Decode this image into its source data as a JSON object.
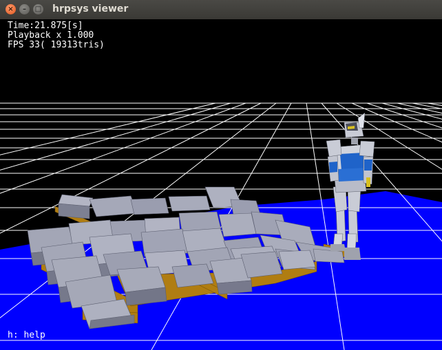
{
  "window": {
    "title": "hrpsys viewer",
    "buttons": {
      "close": "×",
      "minimize": "–",
      "maximize": "□"
    }
  },
  "overlay": {
    "time": "Time:21.875[s]",
    "playback": "Playback x 1.000",
    "fps": "FPS 33( 19313tris)",
    "help": "h: help"
  },
  "scene": {
    "floor_color": "#0000ff",
    "grid_color": "#ffffff",
    "block_color": "#9fa2b5",
    "plank_color": "#b07d12",
    "robot_colors": [
      "#c8cbd6",
      "#1f63c9",
      "#d8c020"
    ]
  }
}
